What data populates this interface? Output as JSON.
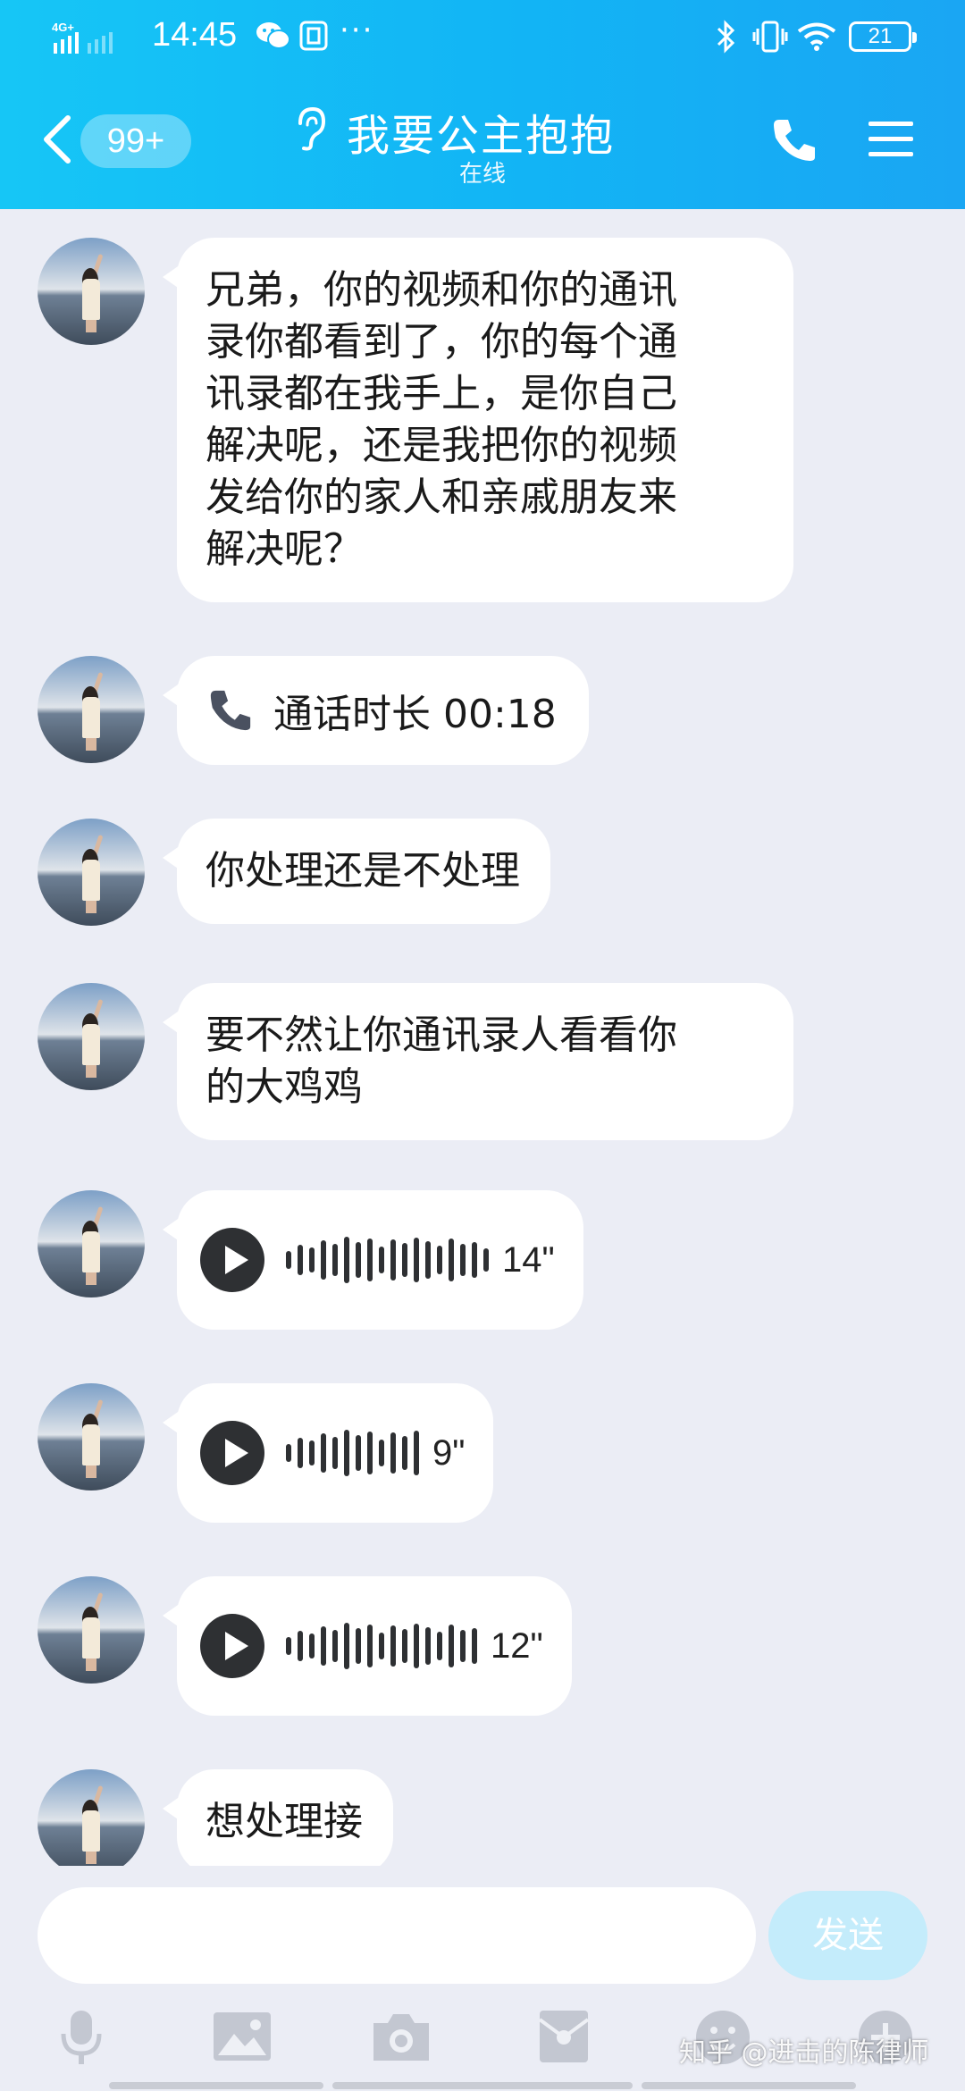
{
  "status_bar": {
    "network": "4G+",
    "time": "14:45",
    "more": "···",
    "battery": "21"
  },
  "header": {
    "unread_count": "99+",
    "title": "我要公主抱抱",
    "status": "在线"
  },
  "messages": [
    {
      "type": "text",
      "text": "兄弟，你的视频和你的通讯\n录你都看到了，你的每个通\n讯录都在我手上，是你自己\n解决呢，还是我把你的视频\n发给你的家人和亲戚朋友来\n解决呢？"
    },
    {
      "type": "call",
      "label": "通话时长 00:18"
    },
    {
      "type": "text",
      "text": "你处理还是不处理"
    },
    {
      "type": "text",
      "text": "要不然让你通讯录人看看你\n的大鸡鸡"
    },
    {
      "type": "voice",
      "duration": "14\""
    },
    {
      "type": "voice",
      "duration": "9\""
    },
    {
      "type": "voice",
      "duration": "12\""
    },
    {
      "type": "text",
      "text": "想处理接"
    }
  ],
  "input": {
    "placeholder": "",
    "send_label": "发送"
  },
  "toolbar": [
    "microphone-icon",
    "image-icon",
    "camera-icon",
    "red-packet-icon",
    "emoji-icon",
    "plus-icon"
  ],
  "watermark": "知乎 @进击的陈律师",
  "colors": {
    "header_start": "#16c6f6",
    "header_end": "#1aa6f3",
    "background": "#ebedf5",
    "bubble": "#ffffff",
    "send_button": "#c4ecfb"
  }
}
